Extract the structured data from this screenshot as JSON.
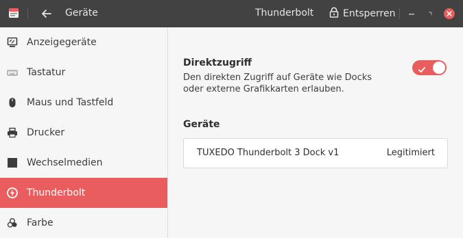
{
  "titlebar": {
    "app_icon": "settings-app-icon",
    "back_icon": "back-arrow-icon",
    "section": "Geräte",
    "title": "Thunderbolt",
    "unlock_label": "Entsperren",
    "unlock_icon": "lock-icon",
    "close_color": "#e95d5e"
  },
  "sidebar": {
    "items": [
      {
        "label": "Anzeigegeräte",
        "icon": "display-icon"
      },
      {
        "label": "Tastatur",
        "icon": "keyboard-icon"
      },
      {
        "label": "Maus und Tastfeld",
        "icon": "mouse-icon"
      },
      {
        "label": "Drucker",
        "icon": "printer-icon"
      },
      {
        "label": "Wechselmedien",
        "icon": "removable-media-icon"
      },
      {
        "label": "Thunderbolt",
        "icon": "thunderbolt-icon",
        "active": true
      },
      {
        "label": "Farbe",
        "icon": "color-icon"
      }
    ]
  },
  "main": {
    "direct_access": {
      "heading": "Direktzugriff",
      "description": "Den direkten Zugriff auf Geräte wie Docks oder externe Grafikkarten erlauben.",
      "enabled": true
    },
    "devices": {
      "heading": "Geräte",
      "rows": [
        {
          "name": "TUXEDO Thunderbolt 3 Dock v1",
          "status": "Legitimiert"
        }
      ]
    }
  },
  "colors": {
    "accent": "#e95d5e",
    "titlebar": "#424242"
  }
}
